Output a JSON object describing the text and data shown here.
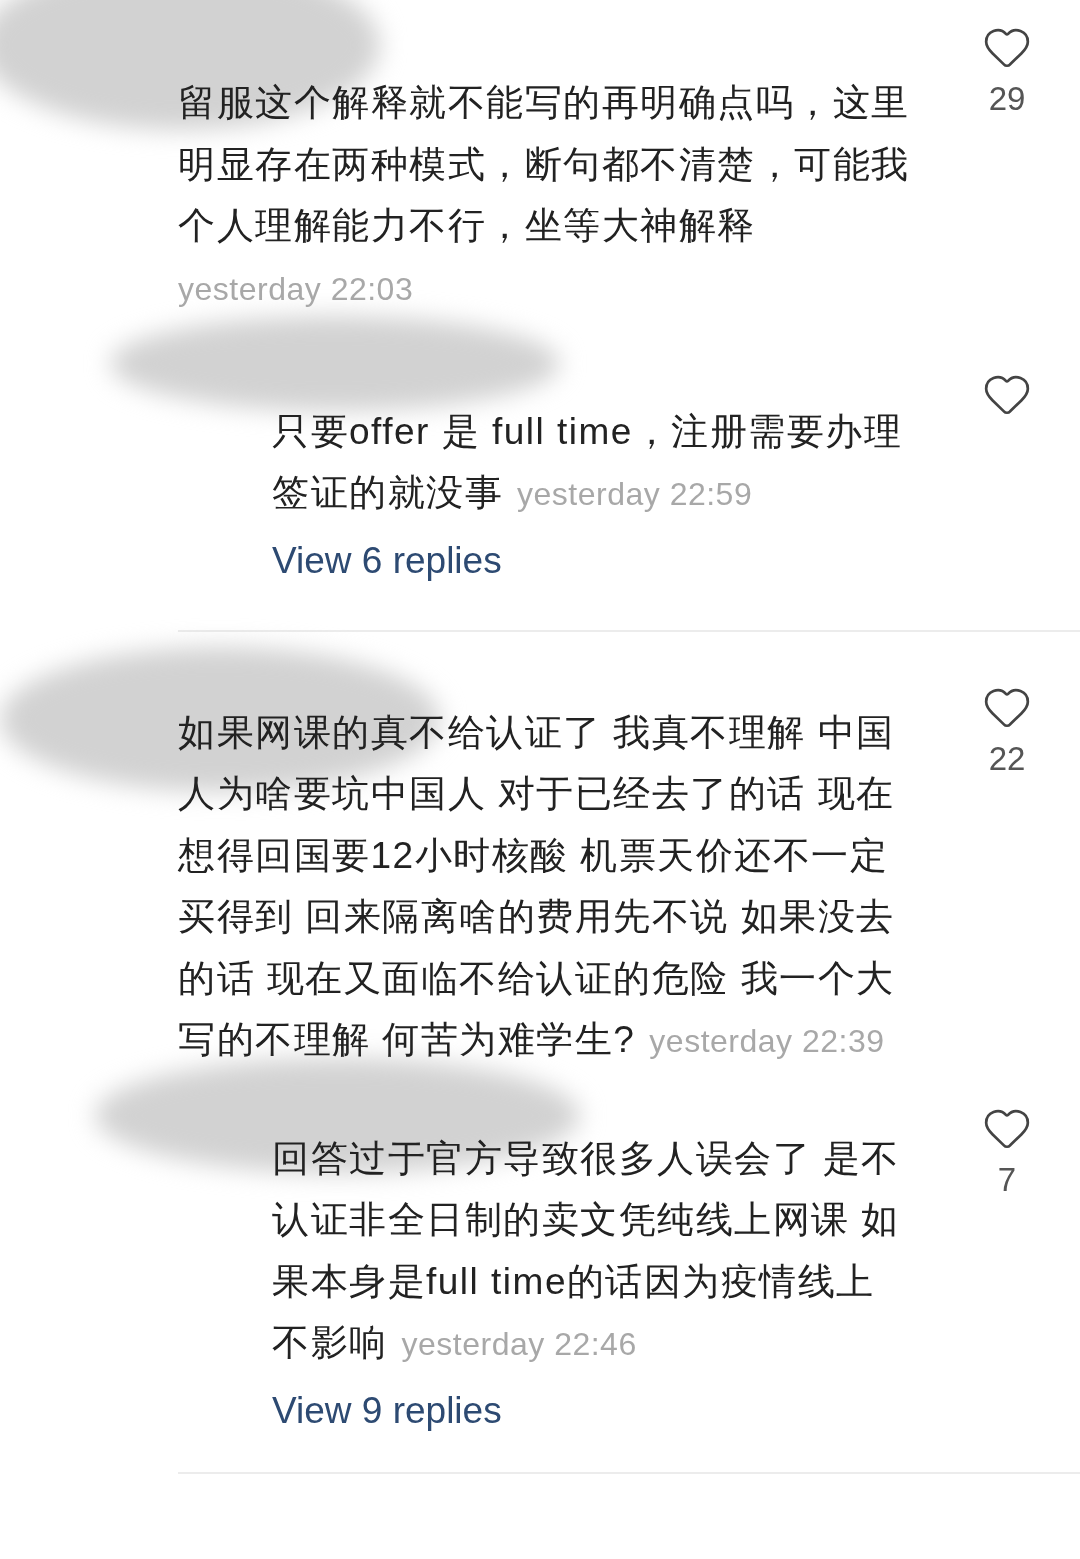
{
  "comments": [
    {
      "lines": [
        "留服这个解释就不能写的再明确点吗，这里",
        "明显存在两种模式，断句都不清楚，可能我",
        "个人理解能力不行，坐等大神解释"
      ],
      "time": "yesterday 22:03",
      "time_inline": false,
      "likes": "29",
      "reply": {
        "lines": [
          "只要offer 是 full time，注册需要办理",
          "签证的就没事"
        ],
        "time": "yesterday 22:59",
        "time_inline": true
      },
      "view_replies": "View 6 replies"
    },
    {
      "lines": [
        "如果网课的真不给认证了 我真不理解 中国",
        "人为啥要坑中国人 对于已经去了的话 现在",
        "想得回国要12小时核酸 机票天价还不一定",
        "买得到 回来隔离啥的费用先不说 如果没去",
        "的话 现在又面临不给认证的危险 我一个大",
        "写的不理解 何苦为难学生?"
      ],
      "time": "yesterday 22:39",
      "time_inline": true,
      "likes": "22",
      "reply": {
        "lines": [
          "回答过于官方导致很多人误会了 是不",
          "认证非全日制的卖文凭纯线上网课 如",
          "果本身是full time的话因为疫情线上",
          "不影响"
        ],
        "time": "yesterday 22:46",
        "time_inline": true,
        "likes": "7"
      },
      "view_replies": "View 9 replies"
    }
  ]
}
